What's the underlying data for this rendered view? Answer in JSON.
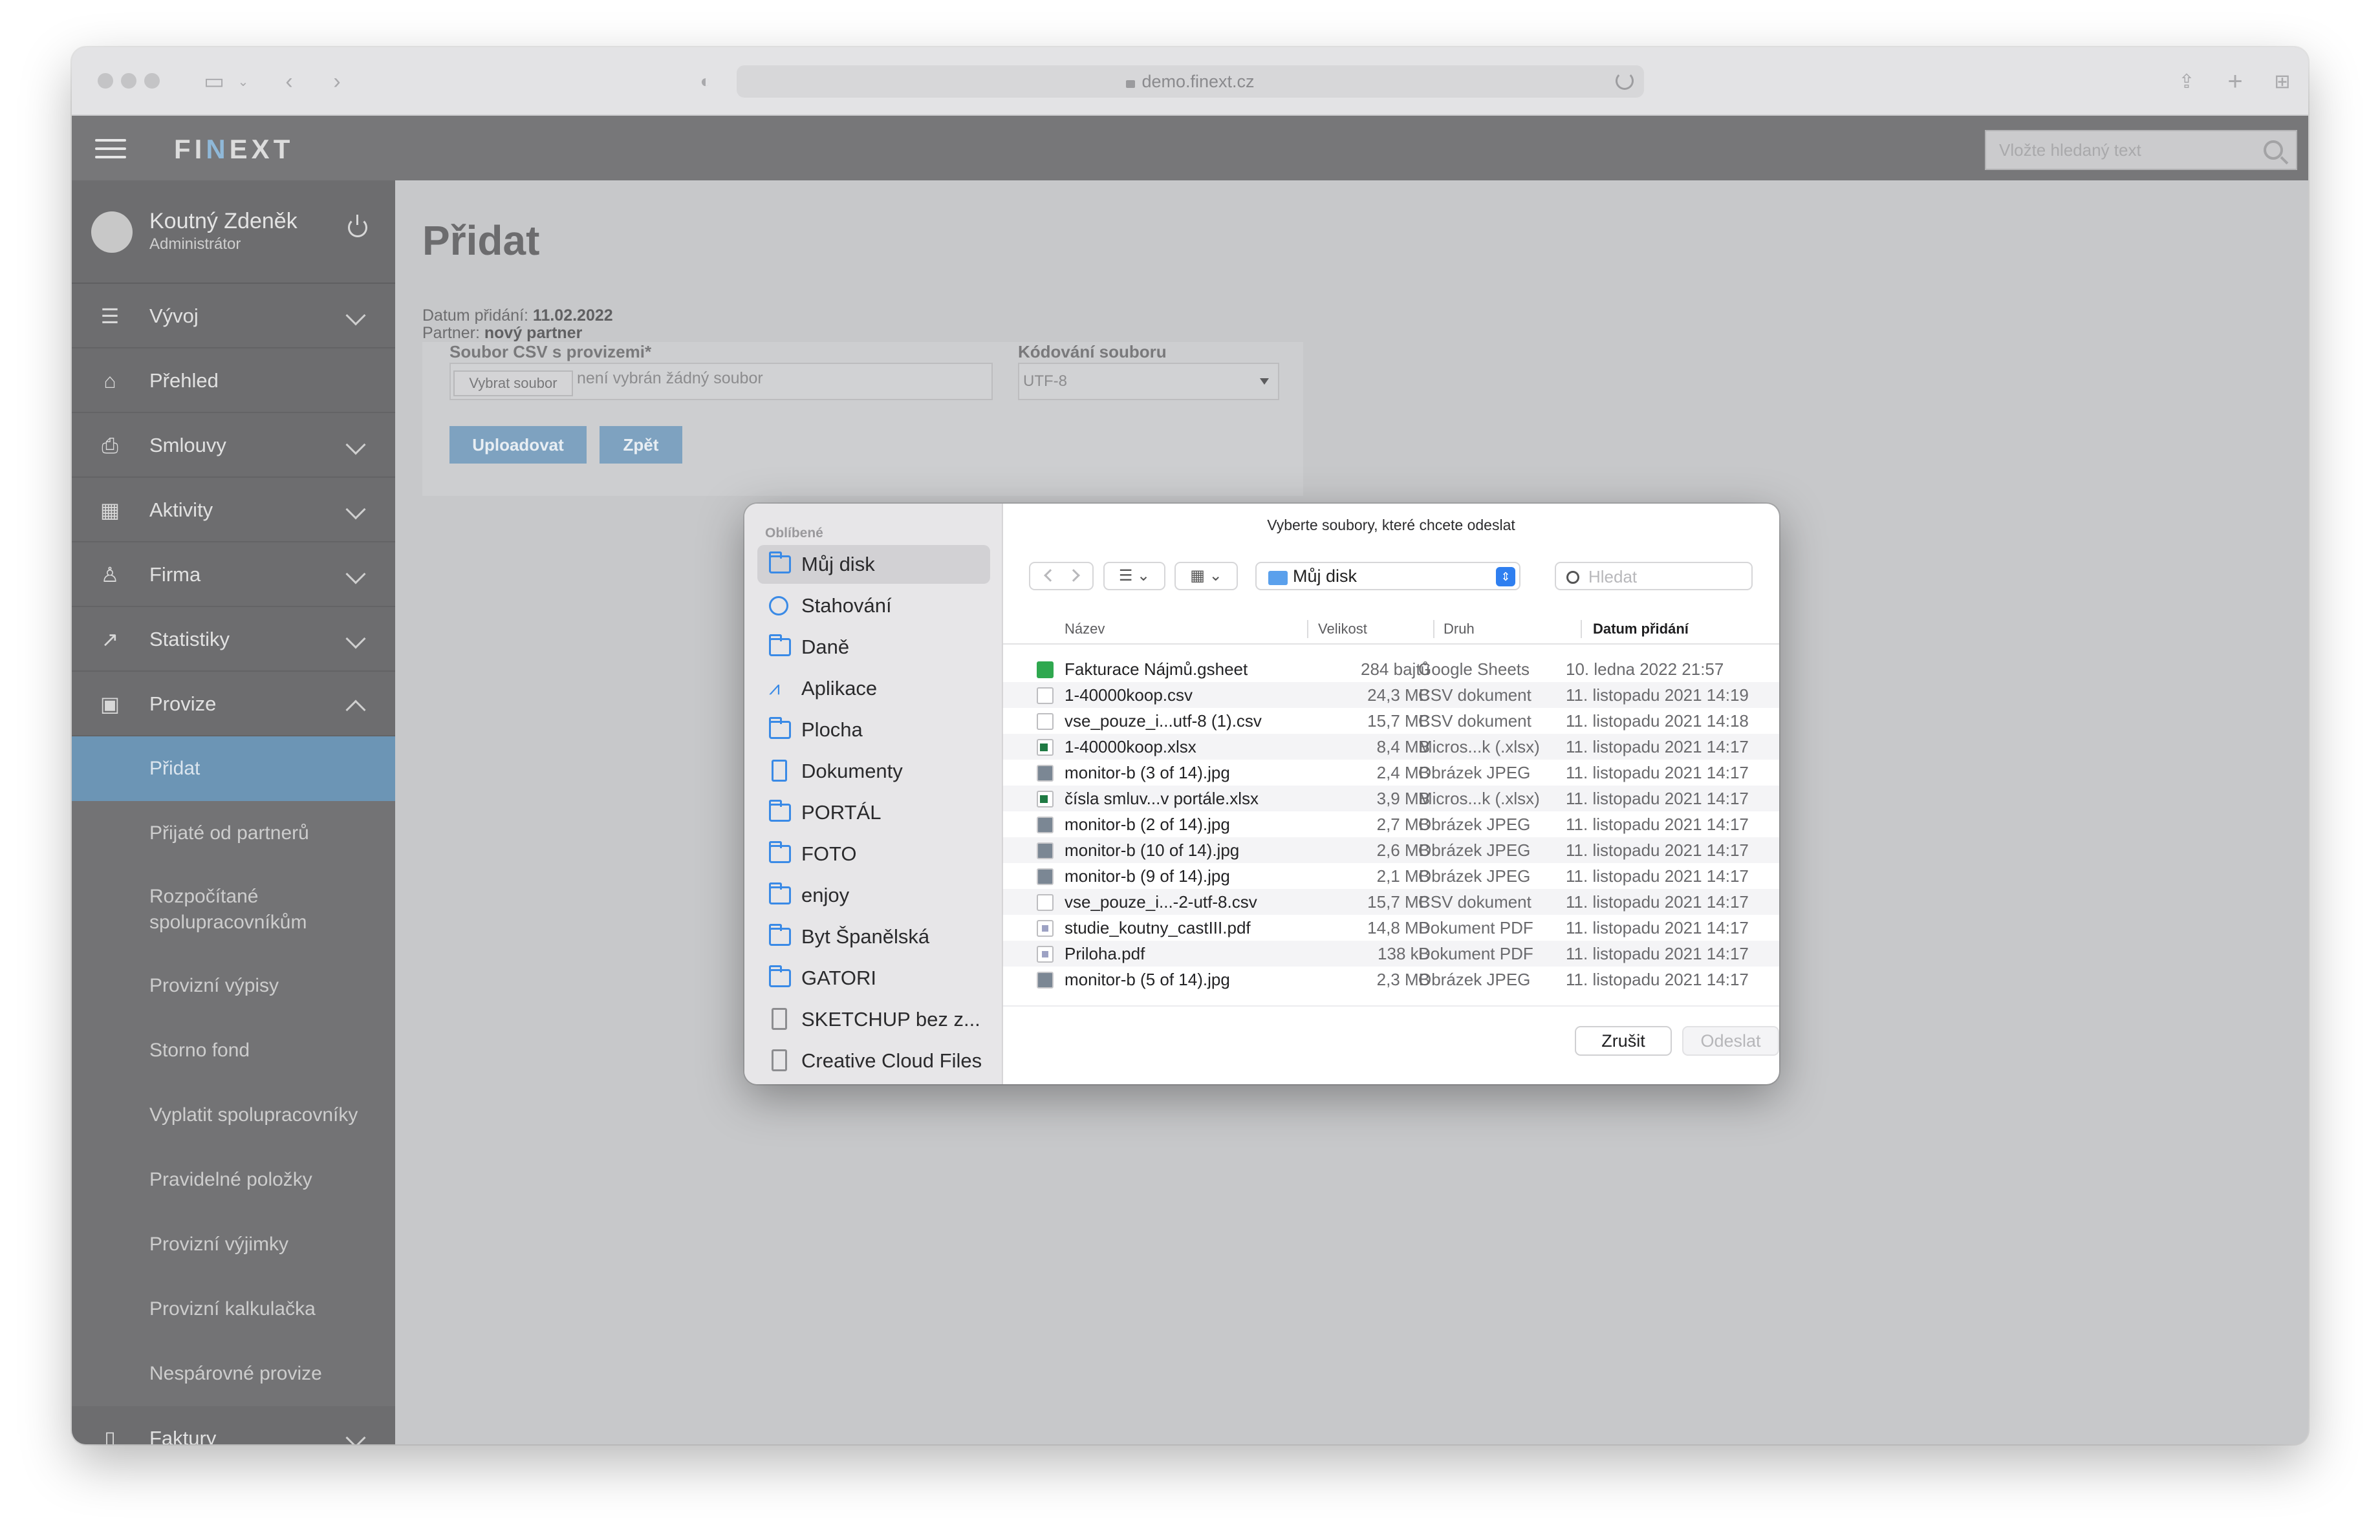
{
  "browser": {
    "url": "demo.finext.cz"
  },
  "app": {
    "logo": "FINEXT",
    "logo_parts": [
      "FI",
      "N",
      "EXT"
    ],
    "search_placeholder": "Vložte hledaný text"
  },
  "user": {
    "name": "Koutný Zdeněk",
    "role": "Administrátor"
  },
  "sidebar": {
    "items": [
      {
        "label": "Vývoj",
        "icon": "sliders-icon",
        "expandable": true
      },
      {
        "label": "Přehled",
        "icon": "home-icon",
        "expandable": false
      },
      {
        "label": "Smlouvy",
        "icon": "printer-icon",
        "expandable": true
      },
      {
        "label": "Aktivity",
        "icon": "calendar-icon",
        "expandable": true
      },
      {
        "label": "Firma",
        "icon": "users-icon",
        "expandable": true
      },
      {
        "label": "Statistiky",
        "icon": "chart-icon",
        "expandable": true
      },
      {
        "label": "Provize",
        "icon": "wallet-icon",
        "expandable": true,
        "expanded": true
      }
    ],
    "subitems": [
      {
        "label": "Přidat",
        "active": true
      },
      {
        "label": "Přijaté od partnerů"
      },
      {
        "label": "Rozpočítané spolupracovníkům"
      },
      {
        "label": "Provizní výpisy"
      },
      {
        "label": "Storno fond"
      },
      {
        "label": "Vyplatit spolupracovníky"
      },
      {
        "label": "Pravidelné položky"
      },
      {
        "label": "Provizní výjimky"
      },
      {
        "label": "Provizní kalkulačka"
      },
      {
        "label": "Nespárovné provize"
      }
    ],
    "last_item": {
      "label": "Faktury",
      "icon": "invoice-icon"
    }
  },
  "page": {
    "title": "Přidat",
    "date_label": "Datum přidání:",
    "date_value": "11.02.2022",
    "partner_label": "Partner:",
    "partner_value": "nový partner",
    "file_label": "Soubor CSV s provizemi*",
    "file_button": "Vybrat soubor",
    "file_status": "není vybrán žádný soubor",
    "encoding_label": "Kódování souboru",
    "encoding_value": "UTF-8",
    "upload_button": "Uploadovat",
    "back_button": "Zpět"
  },
  "dialog": {
    "title": "Vyberte soubory, které chcete odeslat",
    "favorites_title": "Oblíbené",
    "favorites": [
      {
        "label": "Můj disk",
        "icon": "folder-icon",
        "selected": true
      },
      {
        "label": "Stahování",
        "icon": "download-icon"
      },
      {
        "label": "Daně",
        "icon": "folder-icon"
      },
      {
        "label": "Aplikace",
        "icon": "apps-icon"
      },
      {
        "label": "Plocha",
        "icon": "desktop-icon"
      },
      {
        "label": "Dokumenty",
        "icon": "document-icon"
      },
      {
        "label": "PORTÁL",
        "icon": "folder-icon"
      },
      {
        "label": "FOTO",
        "icon": "folder-icon"
      },
      {
        "label": "enjoy",
        "icon": "folder-icon"
      },
      {
        "label": "Byt Španělská",
        "icon": "folder-icon"
      },
      {
        "label": "GATORI",
        "icon": "folder-icon"
      },
      {
        "label": "SKETCHUP bez z...",
        "icon": "file-icon"
      },
      {
        "label": "Creative Cloud Files",
        "icon": "file-icon"
      }
    ],
    "location": "Můj disk",
    "search_placeholder": "Hledat",
    "columns": {
      "name": "Název",
      "size": "Velikost",
      "kind": "Druh",
      "date": "Datum přidání"
    },
    "files": [
      {
        "name": "Fakturace Nájmů.gsheet",
        "size": "284 bajtů",
        "kind": "Google Sheets",
        "date": "10. ledna 2022 21:57",
        "type": "sheet"
      },
      {
        "name": "1-40000koop.csv",
        "size": "24,3 MB",
        "kind": "CSV dokument",
        "date": "11. listopadu 2021 14:19",
        "type": "csv"
      },
      {
        "name": "vse_pouze_i...utf-8 (1).csv",
        "size": "15,7 MB",
        "kind": "CSV dokument",
        "date": "11. listopadu 2021 14:18",
        "type": "csv"
      },
      {
        "name": "1-40000koop.xlsx",
        "size": "8,4 MB",
        "kind": "Micros...k (.xlsx)",
        "date": "11. listopadu 2021 14:17",
        "type": "xlsx"
      },
      {
        "name": "monitor-b (3 of 14).jpg",
        "size": "2,4 MB",
        "kind": "Obrázek JPEG",
        "date": "11. listopadu 2021 14:17",
        "type": "jpg"
      },
      {
        "name": "čísla smluv...v portále.xlsx",
        "size": "3,9 MB",
        "kind": "Micros...k (.xlsx)",
        "date": "11. listopadu 2021 14:17",
        "type": "xlsx"
      },
      {
        "name": "monitor-b (2 of 14).jpg",
        "size": "2,7 MB",
        "kind": "Obrázek JPEG",
        "date": "11. listopadu 2021 14:17",
        "type": "jpg"
      },
      {
        "name": "monitor-b (10 of 14).jpg",
        "size": "2,6 MB",
        "kind": "Obrázek JPEG",
        "date": "11. listopadu 2021 14:17",
        "type": "jpg"
      },
      {
        "name": "monitor-b (9 of 14).jpg",
        "size": "2,1 MB",
        "kind": "Obrázek JPEG",
        "date": "11. listopadu 2021 14:17",
        "type": "jpg"
      },
      {
        "name": "vse_pouze_i...-2-utf-8.csv",
        "size": "15,7 MB",
        "kind": "CSV dokument",
        "date": "11. listopadu 2021 14:17",
        "type": "csv"
      },
      {
        "name": "studie_koutny_castIII.pdf",
        "size": "14,8 MB",
        "kind": "Dokument PDF",
        "date": "11. listopadu 2021 14:17",
        "type": "pdf"
      },
      {
        "name": "Priloha.pdf",
        "size": "138 kB",
        "kind": "Dokument PDF",
        "date": "11. listopadu 2021 14:17",
        "type": "pdf"
      },
      {
        "name": "monitor-b (5 of 14).jpg",
        "size": "2,3 MB",
        "kind": "Obrázek JPEG",
        "date": "11. listopadu 2021 14:17",
        "type": "jpg"
      }
    ],
    "cancel_button": "Zrušit",
    "send_button": "Odeslat"
  },
  "colors": {
    "sidebar_active": "#6c95b5",
    "primary_button": "#7ea2c0",
    "dialog_accent": "#2f7ff0"
  }
}
